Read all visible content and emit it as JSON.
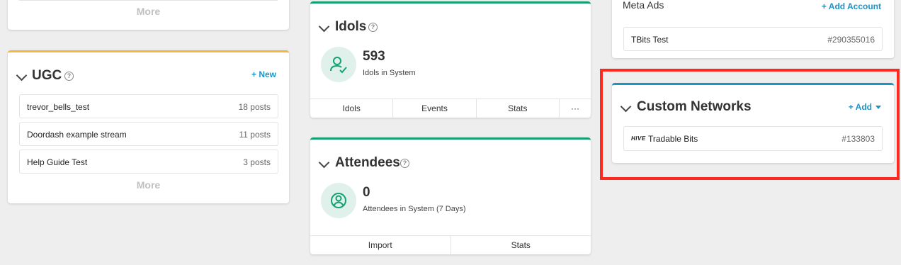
{
  "top_left_card": {
    "more_label": "More"
  },
  "ugc": {
    "title": "UGC",
    "help_glyph": "?",
    "new_label": "+ New",
    "items": [
      {
        "name": "trevor_bells_test",
        "count": "18 posts"
      },
      {
        "name": "Doordash example stream",
        "count": "11 posts"
      },
      {
        "name": "Help Guide Test",
        "count": "3 posts"
      }
    ],
    "more_label": "More"
  },
  "idols": {
    "title": "Idols",
    "help_glyph": "?",
    "value": "593",
    "description": "Idols in System",
    "tabs": [
      "Idols",
      "Events",
      "Stats",
      "···"
    ]
  },
  "attendees": {
    "title": "Attendees",
    "help_glyph": "?",
    "value": "0",
    "description": "Attendees in System (7 Days)",
    "tabs": [
      "Import",
      "Stats"
    ]
  },
  "meta_ads": {
    "title": "Meta Ads",
    "add_account_label": "+ Add Account",
    "items": [
      {
        "name": "TBits Test",
        "id": "#290355016"
      }
    ]
  },
  "custom_networks": {
    "title": "Custom Networks",
    "add_label": "+ Add",
    "items": [
      {
        "logo": "HIVE",
        "name": "Tradable Bits",
        "id": "#133803"
      }
    ]
  },
  "colors": {
    "accent_blue": "#1d94c6",
    "green": "#14a073",
    "orange": "#f4b73e",
    "highlight_red": "#ff2a1f"
  }
}
